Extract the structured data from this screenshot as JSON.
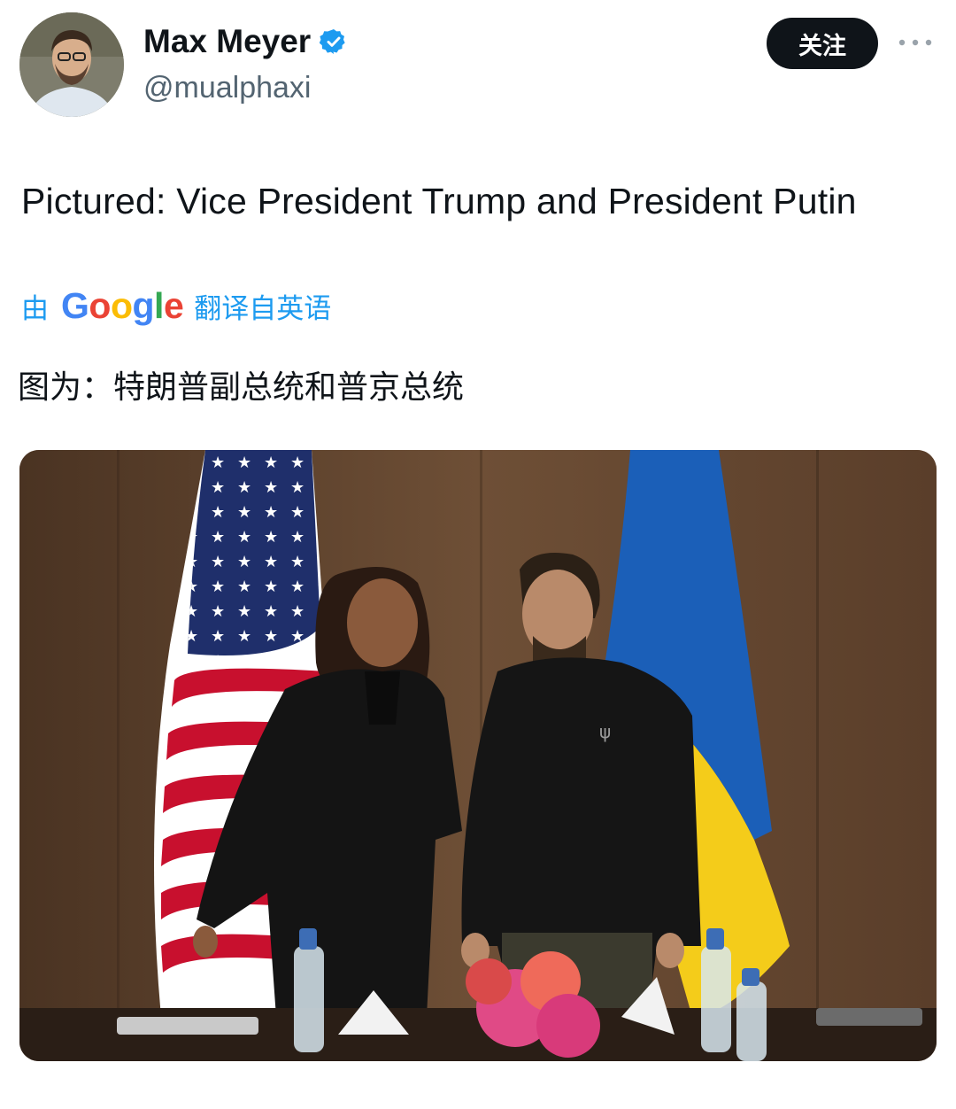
{
  "author": {
    "display_name": "Max Meyer",
    "handle": "@mualphaxi",
    "verified_icon": "verified-badge-icon",
    "avatar_icon": "avatar-photo"
  },
  "actions": {
    "follow_label": "关注",
    "more_icon": "more-horizontal-icon"
  },
  "tweet": {
    "text": "Pictured: Vice President Trump and President Putin"
  },
  "translation": {
    "by_label": "由",
    "provider": {
      "G": "G",
      "o1": "o",
      "o2": "o",
      "g": "g",
      "l": "l",
      "e": "e"
    },
    "suffix_label": "翻译自英语",
    "translated_text": "图为：特朗普副总统和普京总统"
  },
  "media": {
    "image_icon": "tweet-photo"
  },
  "colors": {
    "link_blue": "#1d9bf0",
    "text_dark": "#0f1419",
    "text_muted": "#536471",
    "button_dark": "#0f1419"
  }
}
